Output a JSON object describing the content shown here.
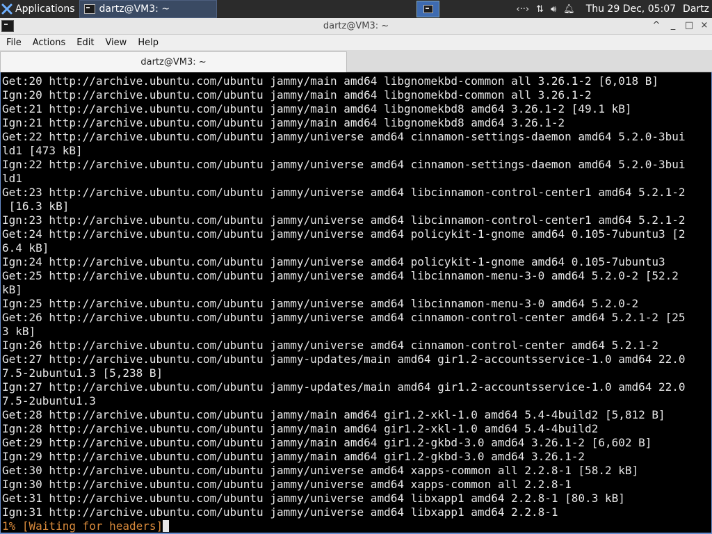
{
  "panel": {
    "apps_label": "Applications",
    "task_label": "dartz@VM3: ~",
    "clock": "Thu 29 Dec, 05:07",
    "user": "Dartz",
    "tray_icons": [
      "network-icon",
      "transfer-icon",
      "volume-icon",
      "notification-bell-icon"
    ]
  },
  "window": {
    "title": "dartz@VM3: ~",
    "controls": [
      "^",
      "_",
      "□",
      "×"
    ]
  },
  "menu": [
    "File",
    "Actions",
    "Edit",
    "View",
    "Help"
  ],
  "tab": {
    "title": "dartz@VM3: ~"
  },
  "terminal": {
    "lines": [
      "Get:20 http://archive.ubuntu.com/ubuntu jammy/main amd64 libgnomekbd-common all 3.26.1-2 [6,018 B]",
      "Ign:20 http://archive.ubuntu.com/ubuntu jammy/main amd64 libgnomekbd-common all 3.26.1-2",
      "Get:21 http://archive.ubuntu.com/ubuntu jammy/main amd64 libgnomekbd8 amd64 3.26.1-2 [49.1 kB]",
      "Ign:21 http://archive.ubuntu.com/ubuntu jammy/main amd64 libgnomekbd8 amd64 3.26.1-2",
      "Get:22 http://archive.ubuntu.com/ubuntu jammy/universe amd64 cinnamon-settings-daemon amd64 5.2.0-3bui",
      "ld1 [473 kB]",
      "Ign:22 http://archive.ubuntu.com/ubuntu jammy/universe amd64 cinnamon-settings-daemon amd64 5.2.0-3bui",
      "ld1",
      "Get:23 http://archive.ubuntu.com/ubuntu jammy/universe amd64 libcinnamon-control-center1 amd64 5.2.1-2",
      " [16.3 kB]",
      "Ign:23 http://archive.ubuntu.com/ubuntu jammy/universe amd64 libcinnamon-control-center1 amd64 5.2.1-2",
      "Get:24 http://archive.ubuntu.com/ubuntu jammy/universe amd64 policykit-1-gnome amd64 0.105-7ubuntu3 [2",
      "6.4 kB]",
      "Ign:24 http://archive.ubuntu.com/ubuntu jammy/universe amd64 policykit-1-gnome amd64 0.105-7ubuntu3",
      "Get:25 http://archive.ubuntu.com/ubuntu jammy/universe amd64 libcinnamon-menu-3-0 amd64 5.2.0-2 [52.2",
      "kB]",
      "Ign:25 http://archive.ubuntu.com/ubuntu jammy/universe amd64 libcinnamon-menu-3-0 amd64 5.2.0-2",
      "Get:26 http://archive.ubuntu.com/ubuntu jammy/universe amd64 cinnamon-control-center amd64 5.2.1-2 [25",
      "3 kB]",
      "Ign:26 http://archive.ubuntu.com/ubuntu jammy/universe amd64 cinnamon-control-center amd64 5.2.1-2",
      "Get:27 http://archive.ubuntu.com/ubuntu jammy-updates/main amd64 gir1.2-accountsservice-1.0 amd64 22.0",
      "7.5-2ubuntu1.3 [5,238 B]",
      "Ign:27 http://archive.ubuntu.com/ubuntu jammy-updates/main amd64 gir1.2-accountsservice-1.0 amd64 22.0",
      "7.5-2ubuntu1.3",
      "Get:28 http://archive.ubuntu.com/ubuntu jammy/main amd64 gir1.2-xkl-1.0 amd64 5.4-4build2 [5,812 B]",
      "Ign:28 http://archive.ubuntu.com/ubuntu jammy/main amd64 gir1.2-xkl-1.0 amd64 5.4-4build2",
      "Get:29 http://archive.ubuntu.com/ubuntu jammy/main amd64 gir1.2-gkbd-3.0 amd64 3.26.1-2 [6,602 B]",
      "Ign:29 http://archive.ubuntu.com/ubuntu jammy/main amd64 gir1.2-gkbd-3.0 amd64 3.26.1-2",
      "Get:30 http://archive.ubuntu.com/ubuntu jammy/universe amd64 xapps-common all 2.2.8-1 [58.2 kB]",
      "Ign:30 http://archive.ubuntu.com/ubuntu jammy/universe amd64 xapps-common all 2.2.8-1",
      "Get:31 http://archive.ubuntu.com/ubuntu jammy/universe amd64 libxapp1 amd64 2.2.8-1 [80.3 kB]",
      "Ign:31 http://archive.ubuntu.com/ubuntu jammy/universe amd64 libxapp1 amd64 2.2.8-1"
    ],
    "progress_line": "1% [Waiting for headers]"
  },
  "colors": {
    "terminal_bg": "#000000",
    "terminal_fg": "#e8e8e8",
    "progress_fg": "#d98a3b",
    "panel_bg": "#2b2b2b",
    "accent": "#6a8fd0"
  }
}
